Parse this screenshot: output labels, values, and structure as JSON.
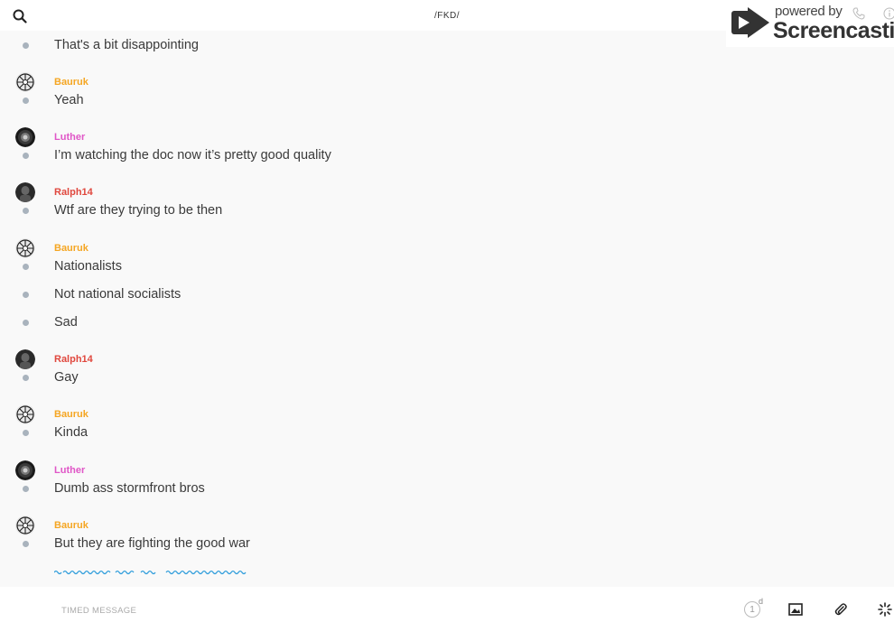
{
  "header": {
    "title": "/FKD/",
    "search_icon": "search-icon"
  },
  "watermark": {
    "powered_by": "powered by",
    "brand": "Screencastify"
  },
  "messages": [
    {
      "author": "",
      "text": "That's a bit disappointing"
    },
    {
      "author": "Bauruk",
      "author_color": "#f5a623",
      "text": "Yeah"
    },
    {
      "author": "Luther",
      "author_color": "#e056c7",
      "text": "I’m watching the doc now it’s pretty good quality"
    },
    {
      "author": "Ralph14",
      "author_color": "#e0483e",
      "text": "Wtf are they trying to be then"
    },
    {
      "author": "Bauruk",
      "author_color": "#f5a623",
      "text": "Nationalists"
    },
    {
      "author": "",
      "text": "Not national socialists"
    },
    {
      "author": "",
      "text": "Sad"
    },
    {
      "author": "Ralph14",
      "author_color": "#e0483e",
      "text": "Gay"
    },
    {
      "author": "Bauruk",
      "author_color": "#f5a623",
      "text": "Kinda"
    },
    {
      "author": "Luther",
      "author_color": "#e056c7",
      "text": "Dumb ass stormfront bros"
    },
    {
      "author": "Bauruk",
      "author_color": "#f5a623",
      "text": "But they are fighting the good war"
    }
  ],
  "composer": {
    "timed_message_label": "TIMED MESSAGE",
    "timer_value": "1",
    "timer_unit": "d",
    "accent_color": "#2d9cdb"
  }
}
